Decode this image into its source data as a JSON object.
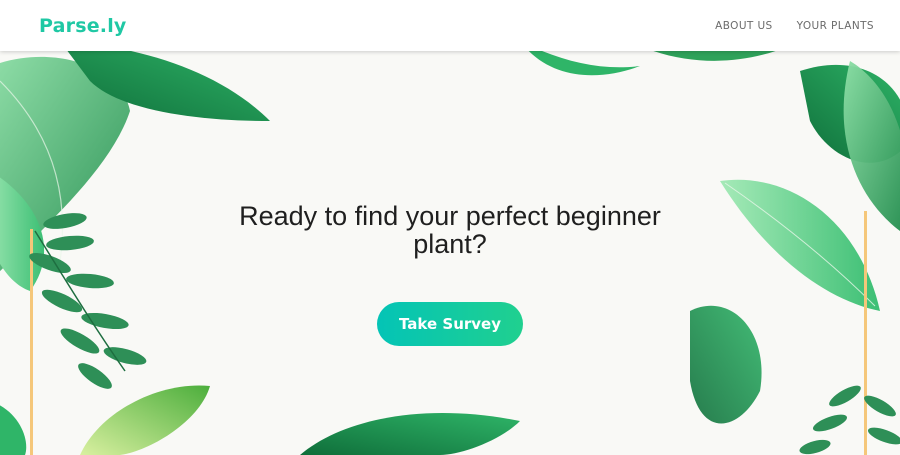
{
  "brand": {
    "name": "Parse.ly"
  },
  "nav": {
    "about": "ABOUT US",
    "plants": "YOUR PLANTS"
  },
  "hero": {
    "heading": "Ready to find your perfect beginner plant?",
    "button_label": "Take Survey"
  },
  "colors": {
    "brand": "#1fc8a4",
    "button_start": "#04c4b6",
    "button_end": "#20d08f",
    "background": "#f9f9f6",
    "leaf_dark": "#1e8a4a",
    "leaf_mid": "#2fb568",
    "leaf_light": "#8fe0a8",
    "gold_stem": "#f5c77a"
  }
}
